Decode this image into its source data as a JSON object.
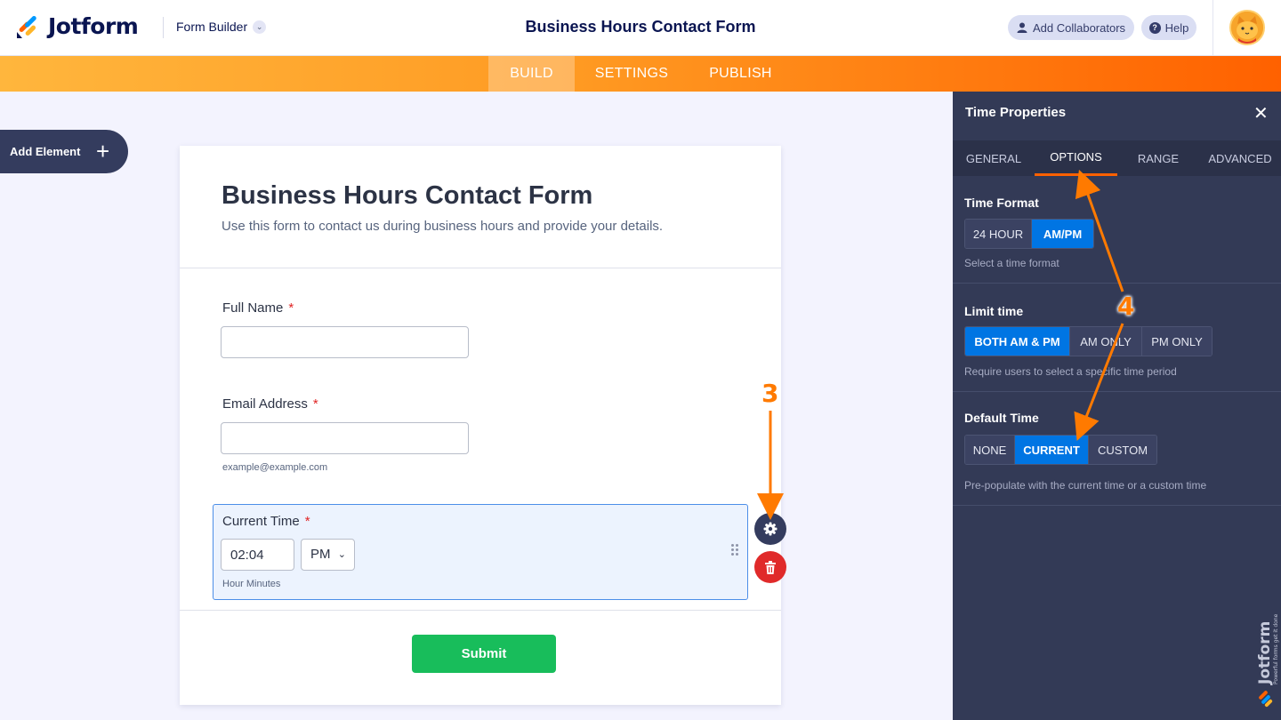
{
  "header": {
    "logo_text": "Jotform",
    "builder_label": "Form Builder",
    "title": "Business Hours Contact Form",
    "collaborators_label": "Add Collaborators",
    "help_label": "Help"
  },
  "nav": {
    "tabs": [
      {
        "label": "BUILD",
        "active": true
      },
      {
        "label": "SETTINGS",
        "active": false
      },
      {
        "label": "PUBLISH",
        "active": false
      }
    ]
  },
  "sidebar": {
    "add_element_label": "Add Element"
  },
  "form": {
    "title": "Business Hours Contact Form",
    "subtitle": "Use this form to contact us during business hours and provide your details.",
    "fields": [
      {
        "label": "Full Name",
        "required": "*",
        "value": ""
      },
      {
        "label": "Email Address",
        "required": "*",
        "value": "",
        "sublabel": "example@example.com"
      },
      {
        "label": "Current Time",
        "required": "*",
        "time_value": "02:04",
        "ampm": "PM",
        "sublabel": "Hour Minutes"
      }
    ],
    "submit_label": "Submit"
  },
  "panel": {
    "title": "Time Properties",
    "tabs": [
      {
        "label": "GENERAL",
        "active": false
      },
      {
        "label": "OPTIONS",
        "active": true
      },
      {
        "label": "RANGE",
        "active": false
      },
      {
        "label": "ADVANCED",
        "active": false
      }
    ],
    "time_format": {
      "title": "Time Format",
      "options": [
        "24 HOUR",
        "AM/PM"
      ],
      "selected": "AM/PM",
      "description": "Select a time format"
    },
    "limit_time": {
      "title": "Limit time",
      "options": [
        "BOTH AM & PM",
        "AM ONLY",
        "PM ONLY"
      ],
      "selected": "BOTH AM & PM",
      "description": "Require users to select a specific time period"
    },
    "default_time": {
      "title": "Default Time",
      "options": [
        "NONE",
        "CURRENT",
        "CUSTOM"
      ],
      "selected": "CURRENT",
      "description": "Pre-populate with the current time or a custom time"
    }
  },
  "annotations": {
    "step_3": "3",
    "step_4": "4"
  },
  "watermark": {
    "brand": "Jotform",
    "tagline": "Powerful forms get it done"
  },
  "colors": {
    "accent_orange": "#ff6100",
    "selected_blue": "#0075e3",
    "panel_bg": "#333a56",
    "submit_green": "#18bd5b",
    "annotation_orange": "#ff7a00"
  }
}
